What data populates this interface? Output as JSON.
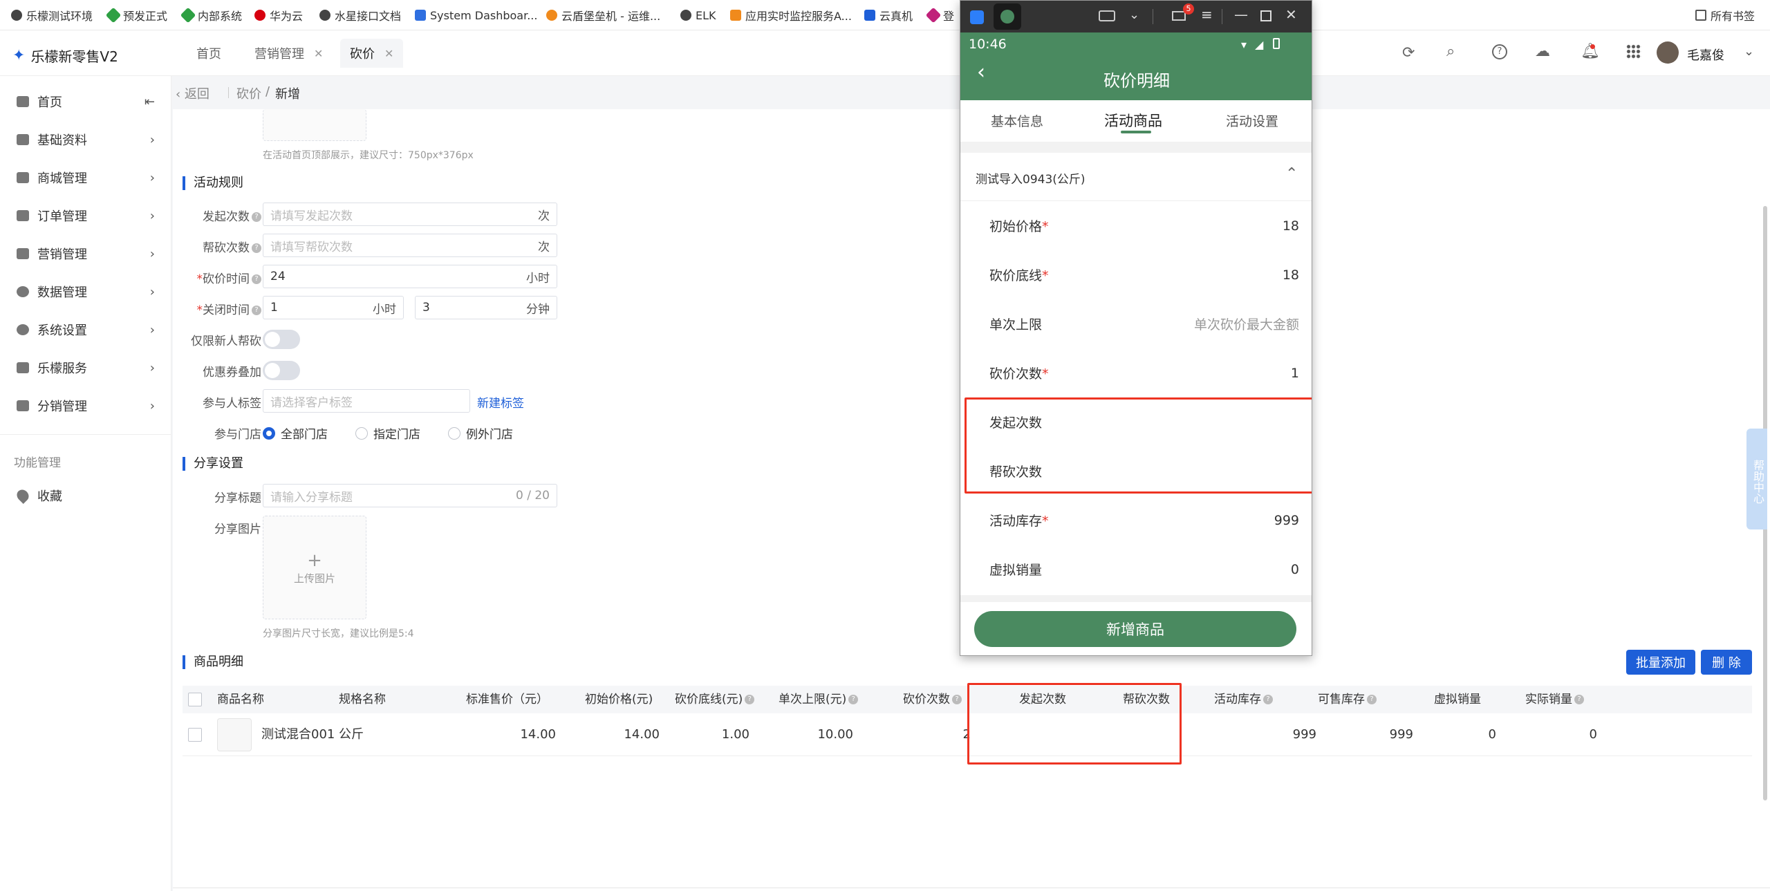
{
  "bookmarks": [
    {
      "label": "乐檬测试环境",
      "color": "#444"
    },
    {
      "label": "预发正式",
      "color": "#2ea043"
    },
    {
      "label": "内部系统",
      "color": "#2ea043"
    },
    {
      "label": "华为云",
      "color": "#d7000f"
    },
    {
      "label": "水星接口文档",
      "color": "#444"
    },
    {
      "label": "System Dashboar...",
      "color": "#2f6fe0"
    },
    {
      "label": "云盾堡垒机 - 运维...",
      "color": "#f08a1c"
    },
    {
      "label": "ELK",
      "color": "#444"
    },
    {
      "label": "应用实时监控服务A...",
      "color": "#f08a1c"
    },
    {
      "label": "云真机",
      "color": "#1e5fd8"
    },
    {
      "label": "登",
      "color": "#c0217a"
    }
  ],
  "all_bookmarks": "所有书签",
  "app": {
    "title": "乐檬新零售V2",
    "tabs": [
      "首页",
      "营销管理",
      "砍价"
    ],
    "user": "毛嘉俊"
  },
  "sidebar": {
    "items": [
      "首页",
      "基础资料",
      "商城管理",
      "订单管理",
      "营销管理",
      "数据管理",
      "系统设置",
      "乐檬服务",
      "分销管理"
    ],
    "func_title": "功能管理",
    "favorites": "收藏"
  },
  "breadcrumb": {
    "back": "返回",
    "path1": "砍价",
    "sep": "/",
    "path2": "新增"
  },
  "form": {
    "banner_hint": "在活动首页顶部展示，建议尺寸：750px*376px",
    "rules_title": "活动规则",
    "initiate_label": "发起次数",
    "initiate_ph": "请填写发起次数",
    "initiate_unit": "次",
    "help_label": "帮砍次数",
    "help_ph": "请填写帮砍次数",
    "help_unit": "次",
    "time_label": "砍价时间",
    "time_value": "24",
    "time_unit": "小时",
    "close_label": "关闭时间",
    "close_hours": "1",
    "close_hours_unit": "小时",
    "close_min": "3",
    "close_min_unit": "分钟",
    "new_only_label": "仅限新人帮砍",
    "coupon_label": "优惠券叠加",
    "tag_label": "参与人标签",
    "tag_ph": "请选择客户标签",
    "tag_new": "新建标签",
    "store_label": "参与门店",
    "store_options": [
      "全部门店",
      "指定门店",
      "例外门店"
    ],
    "share_title": "分享设置",
    "share_title_label": "分享标题",
    "share_title_ph": "请输入分享标题",
    "share_title_count": "0 / 20",
    "share_img_label": "分享图片",
    "upload_label": "上传图片",
    "share_img_hint": "分享图片尺寸长宽，建议比例是5:4"
  },
  "products": {
    "title": "商品明细",
    "batch_add": "批量添加",
    "delete": "删 除",
    "columns": [
      "商品名称",
      "规格名称",
      "标准售价（元）",
      "初始价格(元)",
      "砍价底线(元)",
      "单次上限(元)",
      "砍价次数",
      "发起次数",
      "帮砍次数",
      "活动库存",
      "可售库存",
      "虚拟销量",
      "实际销量"
    ],
    "rows": [
      {
        "name": "测试混合001",
        "spec": "公斤",
        "std_price": "14.00",
        "init_price": "14.00",
        "floor": "1.00",
        "single_limit": "10.00",
        "times": "2",
        "initiate": "",
        "help": "",
        "act_stock": "999",
        "sale_stock": "999",
        "virtual_sales": "0",
        "real_sales": "0"
      }
    ]
  },
  "help_center": "帮助中心",
  "phone": {
    "badge": "5",
    "time": "10:46",
    "title": "砍价明细",
    "tabs": [
      "基本信息",
      "活动商品",
      "活动设置"
    ],
    "product": "测试导入0943(公斤)",
    "rows": [
      {
        "label": "初始价格",
        "req": "*",
        "value": "18"
      },
      {
        "label": "砍价底线",
        "req": "*",
        "value": "18"
      },
      {
        "label": "单次上限",
        "req": "",
        "value": "单次砍价最大金额",
        "placeholder": true
      },
      {
        "label": "砍价次数",
        "req": "*",
        "value": "1"
      },
      {
        "label": "发起次数",
        "req": "",
        "value": ""
      },
      {
        "label": "帮砍次数",
        "req": "",
        "value": ""
      },
      {
        "label": "活动库存",
        "req": "*",
        "value": "999"
      },
      {
        "label": "虚拟销量",
        "req": "",
        "value": "0"
      }
    ],
    "add_button": "新增商品"
  },
  "colors": {
    "primary": "#1e5fd8",
    "phone_green": "#4a8a60",
    "highlight": "#e33322"
  }
}
